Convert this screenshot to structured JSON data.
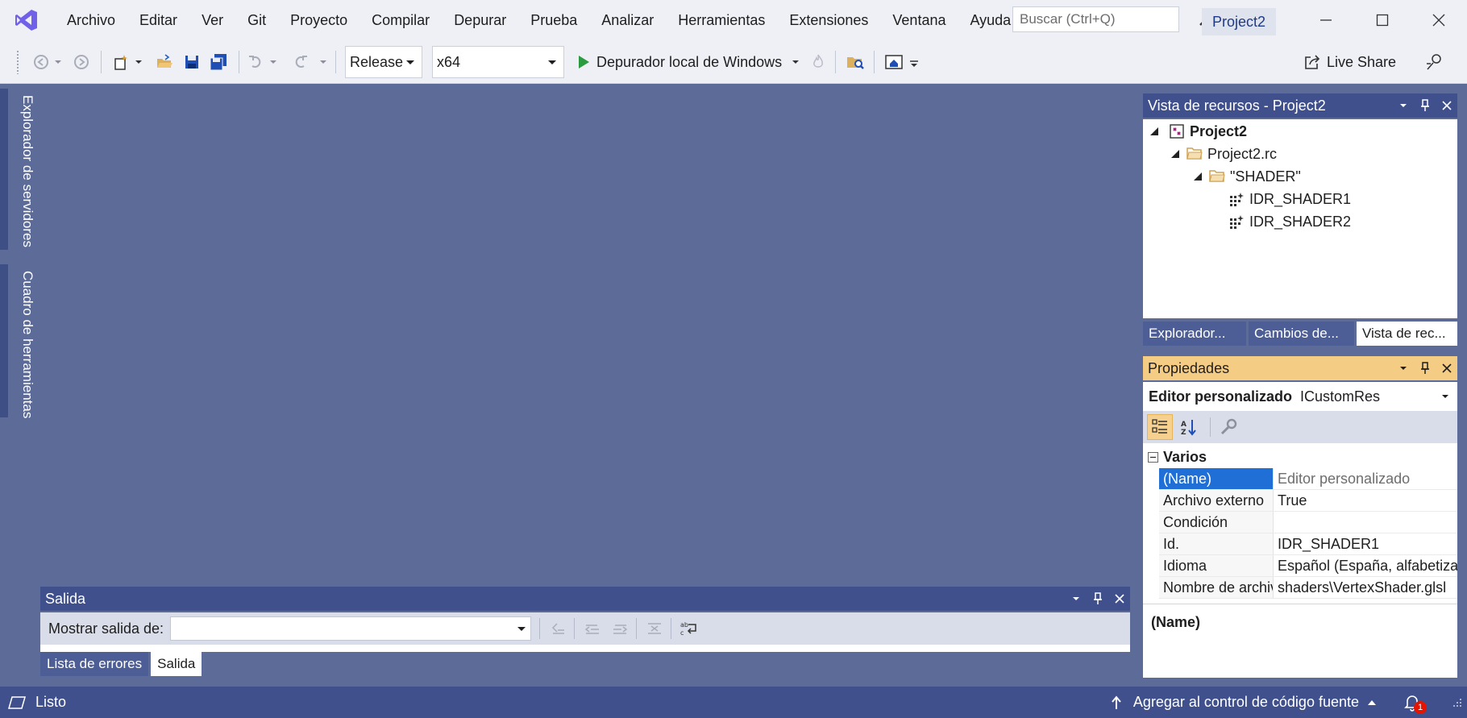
{
  "menu": [
    "Archivo",
    "Editar",
    "Ver",
    "Git",
    "Proyecto",
    "Compilar",
    "Depurar",
    "Prueba",
    "Analizar",
    "Herramientas",
    "Extensiones",
    "Ventana",
    "Ayuda"
  ],
  "search": {
    "placeholder": "Buscar (Ctrl+Q)"
  },
  "project_badge": "Project2",
  "toolbar": {
    "configuration": "Release",
    "platform": "x64",
    "debugger_label": "Depurador local de Windows",
    "live_share": "Live Share"
  },
  "left_tabs": [
    "Explorador de servidores",
    "Cuadro de herramientas"
  ],
  "resource_view": {
    "title": "Vista de recursos - Project2",
    "tree": [
      "Project2",
      "Project2.rc",
      "\"SHADER\"",
      "IDR_SHADER1",
      "IDR_SHADER2"
    ],
    "tabs": [
      "Explorador...",
      "Cambios de...",
      "Vista de rec..."
    ]
  },
  "properties": {
    "title": "Propiedades",
    "object_label": "Editor personalizado",
    "object_type": "ICustomRes",
    "category": "Varios",
    "rows": [
      {
        "name": "(Name)",
        "value": "Editor personalizado"
      },
      {
        "name": "Archivo externo",
        "value": "True"
      },
      {
        "name": "Condición",
        "value": ""
      },
      {
        "name": "Id.",
        "value": "IDR_SHADER1"
      },
      {
        "name": "Idioma",
        "value": "Español (España, alfabetización internacional)"
      },
      {
        "name": "Nombre de archivo",
        "value": "shaders\\VertexShader.glsl"
      }
    ],
    "description_title": "(Name)"
  },
  "output": {
    "title": "Salida",
    "show_from_label": "Mostrar salida de:",
    "tabs": [
      "Lista de errores",
      "Salida"
    ]
  },
  "status": {
    "ready": "Listo",
    "source_control": "Agregar al control de código fuente",
    "notification_count": "1"
  },
  "colors": {
    "accent": "#40508d",
    "background": "#5d6b99",
    "properties_header": "#f5cc84",
    "selection": "#1f6fd6",
    "vs_purple": "#7160e8"
  }
}
